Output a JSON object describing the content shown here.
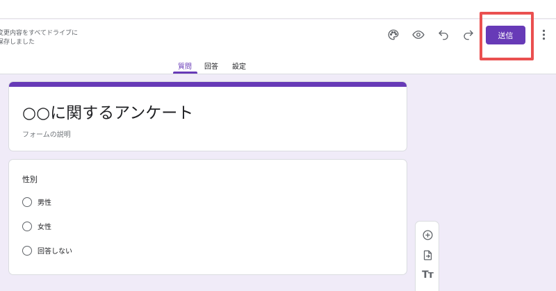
{
  "header": {
    "save_status_line1": "変更内容をすべてドライブに",
    "save_status_line2": "保存しました",
    "icons": [
      "palette-icon",
      "preview-eye-icon",
      "undo-icon",
      "redo-icon",
      "more-vert-icon"
    ],
    "send_label": "送信",
    "accent_color": "#673ab7",
    "highlight_color": "#ea5050"
  },
  "tabs": [
    {
      "label": "質問",
      "active": true
    },
    {
      "label": "回答",
      "active": false
    },
    {
      "label": "設定",
      "active": false
    }
  ],
  "form": {
    "title": "○○に関するアンケート",
    "description_placeholder": "フォームの説明"
  },
  "question": {
    "title": "性別",
    "options": [
      "男性",
      "女性",
      "回答しない"
    ]
  },
  "side_toolbar": {
    "icons": [
      "add-question-icon",
      "import-questions-icon",
      "add-title-text-icon"
    ],
    "title_text_glyph": "Tт"
  }
}
